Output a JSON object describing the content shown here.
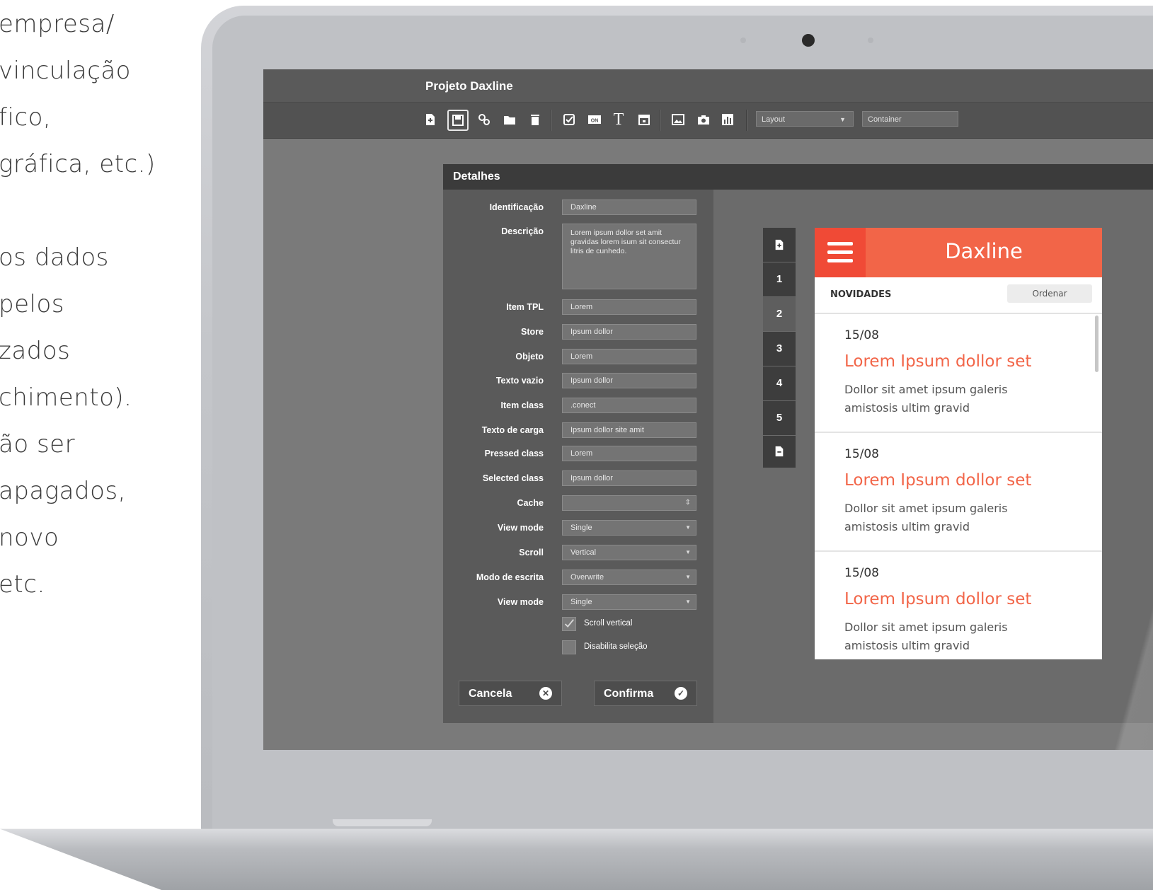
{
  "side_text": [
    "empresa/",
    "vinculação",
    "fico,",
    "gráfica, etc.)",
    "os dados",
    "pelos",
    "zados",
    "chimento).",
    "ão ser",
    "apagados,",
    "novo",
    "etc."
  ],
  "app": {
    "title": "Projeto Daxline",
    "toolbar": {
      "icons": [
        "new-file-icon",
        "save-icon",
        "settings-icon",
        "folder-open-icon",
        "trash-icon",
        "checkbox-icon",
        "toggle-on-icon",
        "text-icon",
        "calendar-icon",
        "image-icon",
        "camera-icon",
        "chart-icon"
      ],
      "toggle_label": "ON",
      "text_glyph": "T",
      "layout_select": "Layout",
      "container_field": "Container"
    }
  },
  "dialog": {
    "title": "Detalhes",
    "fields": [
      {
        "label": "Identificação",
        "value": "Daxline",
        "kind": "input"
      },
      {
        "label": "Descrição",
        "value": "Lorem ipsum dollor set amit gravidas lorem isum sit consectur litris de cunhedo.",
        "kind": "textarea"
      },
      {
        "label": "Item TPL",
        "value": "Lorem",
        "kind": "input"
      },
      {
        "label": "Store",
        "value": "Ipsum dollor",
        "kind": "input"
      },
      {
        "label": "Objeto",
        "value": "Lorem",
        "kind": "input"
      },
      {
        "label": "Texto vazio",
        "value": "Ipsum dollor",
        "kind": "input"
      },
      {
        "label": "Item class",
        "value": ".conect",
        "kind": "input"
      },
      {
        "label": "Texto de carga",
        "value": "Ipsum dollor site amit",
        "kind": "input"
      },
      {
        "label": "Pressed class",
        "value": "Lorem",
        "kind": "input"
      },
      {
        "label": "Selected class",
        "value": "Ipsum dollor",
        "kind": "input"
      },
      {
        "label": "Cache",
        "value": "",
        "kind": "stepper"
      },
      {
        "label": "View mode",
        "value": "Single",
        "kind": "select"
      },
      {
        "label": "Scroll",
        "value": "Vertical",
        "kind": "select"
      },
      {
        "label": "Modo de escrita",
        "value": "Overwrite",
        "kind": "select"
      },
      {
        "label": "View mode",
        "value": "Single",
        "kind": "select"
      }
    ],
    "checkboxes": [
      {
        "label": "Scroll vertical",
        "checked": true
      },
      {
        "label": "Disabilita seleção",
        "checked": false
      }
    ],
    "buttons": {
      "cancel": "Cancela",
      "confirm": "Confirma"
    }
  },
  "page_tabs": [
    "+",
    "1",
    "2",
    "3",
    "4",
    "5",
    "−"
  ],
  "active_page_tab": "2",
  "preview": {
    "brand": "Daxline",
    "section": "NOVIDADES",
    "sort_button": "Ordenar",
    "cards": [
      {
        "date": "15/08",
        "title": "Lorem Ipsum dollor set",
        "desc": "Dollor sit amet ipsum galeris amistosis ultim gravid"
      },
      {
        "date": "15/08",
        "title": "Lorem Ipsum dollor set",
        "desc": "Dollor sit amet ipsum galeris amistosis ultim gravid"
      },
      {
        "date": "15/08",
        "title": "Lorem Ipsum dollor set",
        "desc": "Dollor sit amet ipsum galeris amistosis ultim gravid"
      }
    ]
  },
  "colors": {
    "accent": "#f26548",
    "accent_dark": "#f04a36",
    "panel": "#5a5a5a",
    "titlebar": "#5a5a5a"
  }
}
